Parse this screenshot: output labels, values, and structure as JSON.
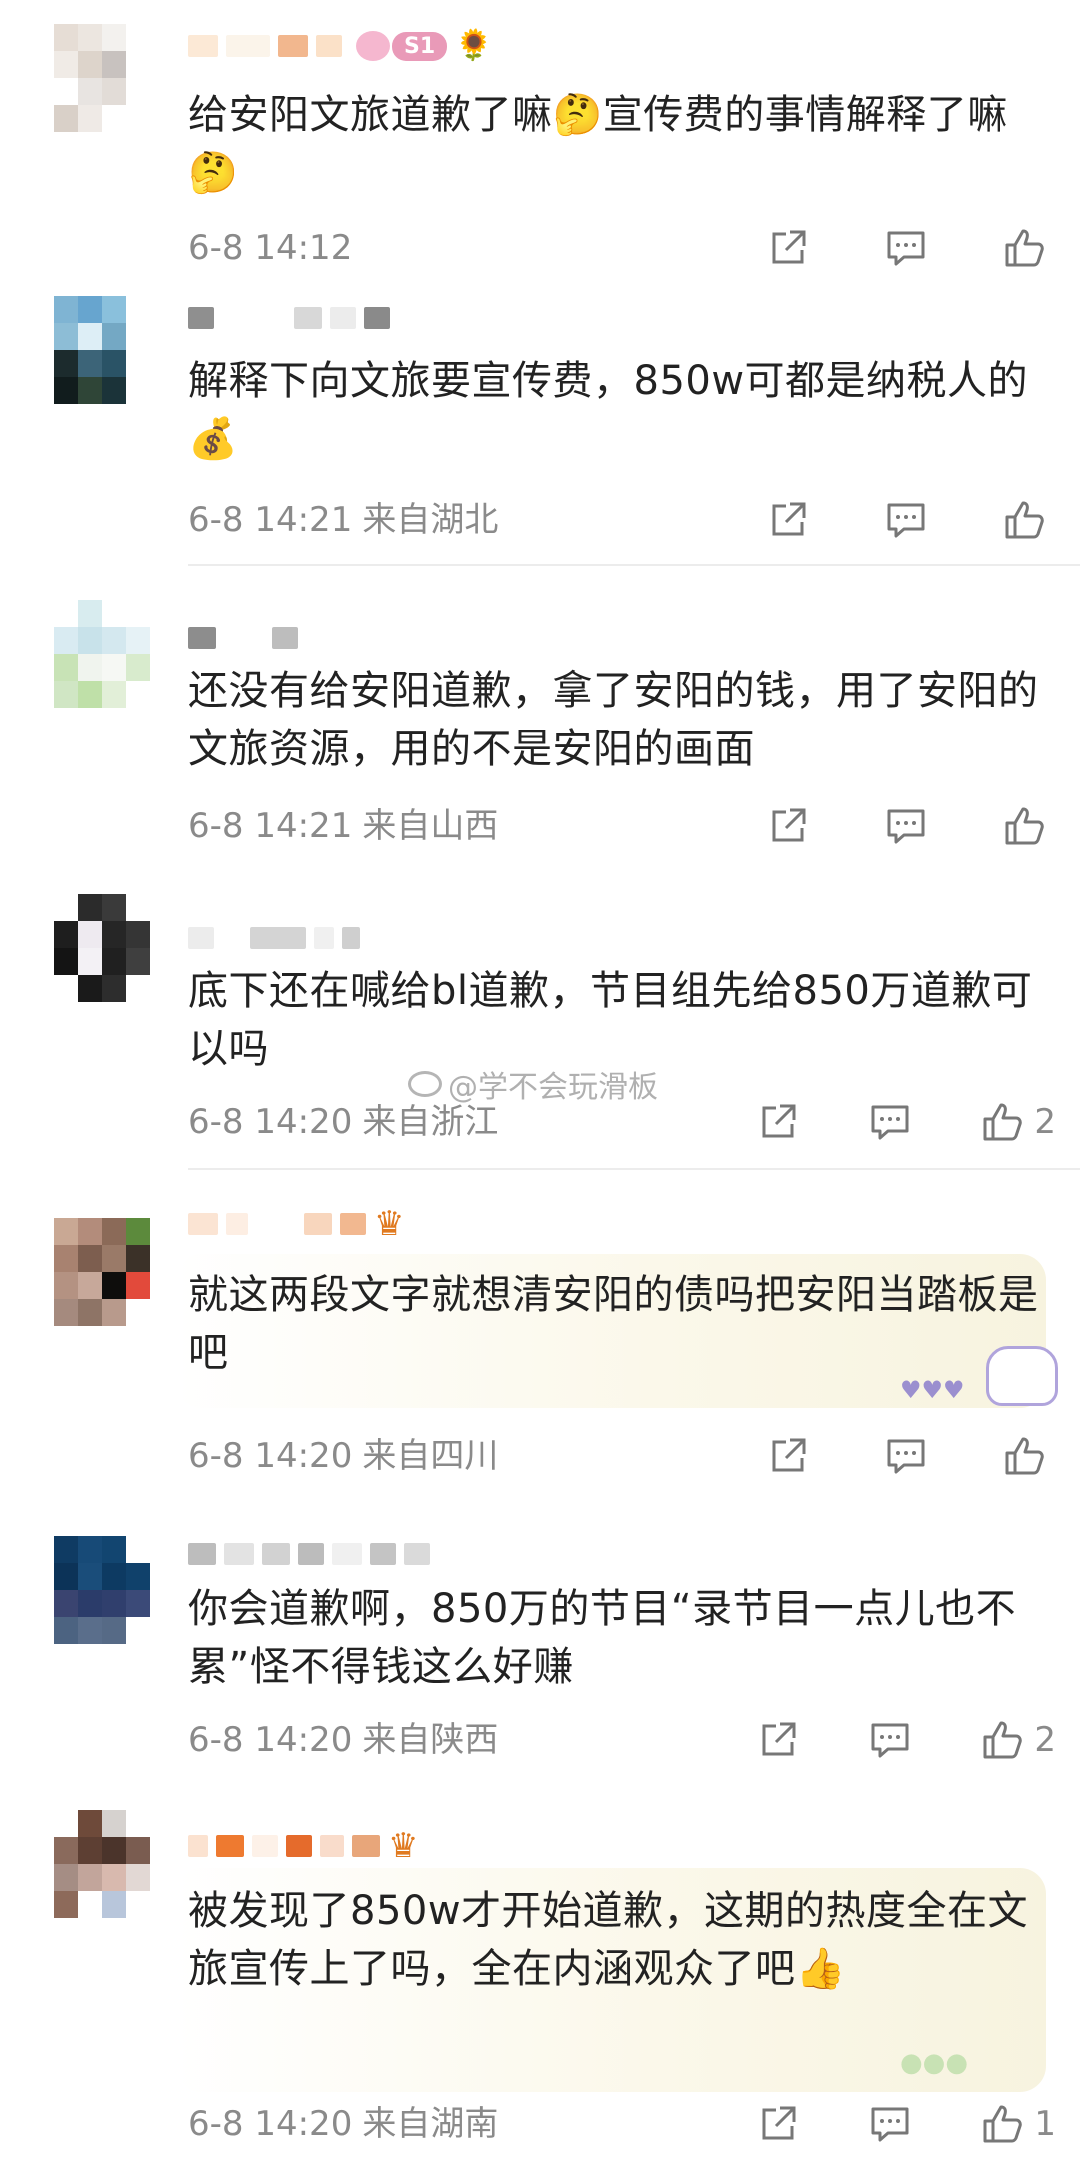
{
  "comments": [
    {
      "text": "给安阳文旅道歉了嘛🤔宣传费的事情解释了嘛🤔",
      "time": "6-8 14:12",
      "location": "",
      "likes": "",
      "badge": "S1",
      "flower": "🌻"
    },
    {
      "text": "解释下向文旅要宣传费，850w可都是纳税人的💰",
      "time": "6-8 14:21",
      "location": "来自湖北",
      "likes": ""
    },
    {
      "text": "还没有给安阳道歉，拿了安阳的钱，用了安阳的文旅资源，用的不是安阳的画面",
      "time": "6-8 14:21",
      "location": "来自山西",
      "likes": ""
    },
    {
      "text": "底下还在喊给bl道歉，节目组先给850万道歉可以吗",
      "time": "6-8 14:20",
      "location": "来自浙江",
      "likes": "2"
    },
    {
      "text": "就这两段文字就想清安阳的债吗把安阳当踏板是吧",
      "time": "6-8 14:20",
      "location": "来自四川",
      "likes": ""
    },
    {
      "text": "你会道歉啊，850万的节目“录节目一点儿也不累”怪不得钱这么好赚",
      "time": "6-8 14:20",
      "location": "来自陕西",
      "likes": "2"
    },
    {
      "text": "被发现了850w才开始道歉，这期的热度全在文旅宣传上了吗，全在内涵观众了吧👍",
      "time": "6-8 14:20",
      "location": "来自湖南",
      "likes": "1"
    }
  ],
  "watermark": "@学不会玩滑板",
  "icons": {
    "share": "share-icon",
    "reply": "comment-icon",
    "like": "thumbs-up-icon"
  },
  "colors": {
    "text": "#222222",
    "meta": "#8a8a8a",
    "divider": "#ececec"
  }
}
